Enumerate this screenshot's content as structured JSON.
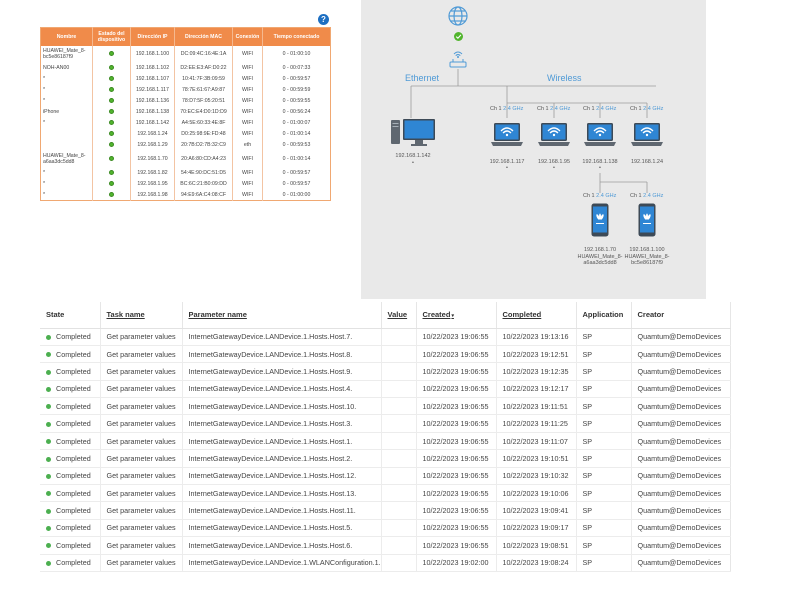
{
  "router": {
    "help_icon": "?",
    "headers": [
      "Nombre",
      "Estado del dispositivo",
      "Dirección IP",
      "Dirección MAC",
      "Conexión",
      "Tiempo conectado"
    ],
    "rows": [
      {
        "name": "HUAWEI_Mate_8-bc5e86187f9",
        "ip": "192.168.1.100",
        "mac": "DC:09:4C:16:4E:1A",
        "conn": "WIFI",
        "time": "0 - 01:00:10",
        "tall": true
      },
      {
        "name": "NOH-AN00",
        "ip": "192.168.1.102",
        "mac": "D2:EE:E3:AF:D0:22",
        "conn": "WIFI",
        "time": "0 - 00:07:33",
        "tall": false
      },
      {
        "name": "*",
        "ip": "192.168.1.107",
        "mac": "10:41:7F:3B:09:59",
        "conn": "WIFI",
        "time": "0 - 00:59:57",
        "tall": false
      },
      {
        "name": "*",
        "ip": "192.168.1.117",
        "mac": "78:7E:61:67:A9:87",
        "conn": "WIFI",
        "time": "0 - 00:59:59",
        "tall": false
      },
      {
        "name": "*",
        "ip": "192.168.1.136",
        "mac": "78:D7:5F:05:20:51",
        "conn": "WIFI",
        "time": "0 - 00:59:55",
        "tall": false
      },
      {
        "name": "iPhone",
        "ip": "192.168.1.138",
        "mac": "70:EC:E4:D0:1D:D9",
        "conn": "WIFI",
        "time": "0 - 00:56:24",
        "tall": false
      },
      {
        "name": "*",
        "ip": "192.168.1.142",
        "mac": "A4:5E:60:33:4E:8F",
        "conn": "WIFI",
        "time": "0 - 01:00:07",
        "tall": false
      },
      {
        "name": "",
        "ip": "192.168.1.24",
        "mac": "D0:25:98:9E:FD:48",
        "conn": "WIFI",
        "time": "0 - 01:00:14",
        "tall": false
      },
      {
        "name": "",
        "ip": "192.168.1.29",
        "mac": "20:7B:D2:7B:32:C9",
        "conn": "eth",
        "time": "0 - 00:59:53",
        "tall": false
      },
      {
        "name": "HUAWEI_Mate_8-a6aa3dc5dd8",
        "ip": "192.168.1.70",
        "mac": "20:A6:80:CD:A4:23",
        "conn": "WIFI",
        "time": "0 - 01:00:14",
        "tall": true
      },
      {
        "name": "*",
        "ip": "192.168.1.82",
        "mac": "54:4E:90:DC:51:D5",
        "conn": "WIFI",
        "time": "0 - 00:59:57",
        "tall": false
      },
      {
        "name": "*",
        "ip": "192.168.1.95",
        "mac": "BC:6C:21:B0:09:DD",
        "conn": "WIFI",
        "time": "0 - 00:59:57",
        "tall": false
      },
      {
        "name": "*",
        "ip": "192.168.1.98",
        "mac": "94:E9:6A:C4:08:CF",
        "conn": "WIFI",
        "time": "0 - 01:00:00",
        "tall": false
      }
    ]
  },
  "topology": {
    "ethernet_label": "Ethernet",
    "wireless_label": "Wireless",
    "channel_prefix": "Ch 1",
    "band": "2.4 GHz",
    "pc_ip": "192.168.1.142",
    "pc_mark": "•",
    "laptops": [
      {
        "ip": "192.168.1.117",
        "mark": "•"
      },
      {
        "ip": "192.168.1.95",
        "mark": "•"
      },
      {
        "ip": "192.168.1.138",
        "mark": "•"
      },
      {
        "ip": "192.168.1.24",
        "mark": ""
      }
    ],
    "phones": [
      {
        "ip": "192.168.1.70",
        "name": "HUAWEI_Mate_8-a6aa3dc5dd8"
      },
      {
        "ip": "192.168.1.100",
        "name": "HUAWEI_Mate_8-bc5e86187f9"
      }
    ],
    "colors": {
      "blue": "#4f9ad6",
      "green": "#52b52e",
      "bg": "#e9e9e9"
    }
  },
  "tasks": {
    "headers": {
      "state": "State",
      "task": "Task name",
      "param": "Parameter name",
      "value": "Value",
      "created": "Created",
      "completed": "Completed",
      "application": "Application",
      "creator": "Creator"
    },
    "sort_arrow": "▾",
    "rows": [
      {
        "state": "Completed",
        "task": "Get parameter values",
        "param": "InternetGatewayDevice.LANDevice.1.Hosts.Host.7.",
        "value": "",
        "created": "10/22/2023 19:06:55",
        "completed": "10/22/2023 19:13:16",
        "app": "SP",
        "creator": "Quamtum@DemoDevices"
      },
      {
        "state": "Completed",
        "task": "Get parameter values",
        "param": "InternetGatewayDevice.LANDevice.1.Hosts.Host.8.",
        "value": "",
        "created": "10/22/2023 19:06:55",
        "completed": "10/22/2023 19:12:51",
        "app": "SP",
        "creator": "Quamtum@DemoDevices"
      },
      {
        "state": "Completed",
        "task": "Get parameter values",
        "param": "InternetGatewayDevice.LANDevice.1.Hosts.Host.9.",
        "value": "",
        "created": "10/22/2023 19:06:55",
        "completed": "10/22/2023 19:12:35",
        "app": "SP",
        "creator": "Quamtum@DemoDevices"
      },
      {
        "state": "Completed",
        "task": "Get parameter values",
        "param": "InternetGatewayDevice.LANDevice.1.Hosts.Host.4.",
        "value": "",
        "created": "10/22/2023 19:06:55",
        "completed": "10/22/2023 19:12:17",
        "app": "SP",
        "creator": "Quamtum@DemoDevices"
      },
      {
        "state": "Completed",
        "task": "Get parameter values",
        "param": "InternetGatewayDevice.LANDevice.1.Hosts.Host.10.",
        "value": "",
        "created": "10/22/2023 19:06:55",
        "completed": "10/22/2023 19:11:51",
        "app": "SP",
        "creator": "Quamtum@DemoDevices"
      },
      {
        "state": "Completed",
        "task": "Get parameter values",
        "param": "InternetGatewayDevice.LANDevice.1.Hosts.Host.3.",
        "value": "",
        "created": "10/22/2023 19:06:55",
        "completed": "10/22/2023 19:11:25",
        "app": "SP",
        "creator": "Quamtum@DemoDevices"
      },
      {
        "state": "Completed",
        "task": "Get parameter values",
        "param": "InternetGatewayDevice.LANDevice.1.Hosts.Host.1.",
        "value": "",
        "created": "10/22/2023 19:06:55",
        "completed": "10/22/2023 19:11:07",
        "app": "SP",
        "creator": "Quamtum@DemoDevices"
      },
      {
        "state": "Completed",
        "task": "Get parameter values",
        "param": "InternetGatewayDevice.LANDevice.1.Hosts.Host.2.",
        "value": "",
        "created": "10/22/2023 19:06:55",
        "completed": "10/22/2023 19:10:51",
        "app": "SP",
        "creator": "Quamtum@DemoDevices"
      },
      {
        "state": "Completed",
        "task": "Get parameter values",
        "param": "InternetGatewayDevice.LANDevice.1.Hosts.Host.12.",
        "value": "",
        "created": "10/22/2023 19:06:55",
        "completed": "10/22/2023 19:10:32",
        "app": "SP",
        "creator": "Quamtum@DemoDevices"
      },
      {
        "state": "Completed",
        "task": "Get parameter values",
        "param": "InternetGatewayDevice.LANDevice.1.Hosts.Host.13.",
        "value": "",
        "created": "10/22/2023 19:06:55",
        "completed": "10/22/2023 19:10:06",
        "app": "SP",
        "creator": "Quamtum@DemoDevices"
      },
      {
        "state": "Completed",
        "task": "Get parameter values",
        "param": "InternetGatewayDevice.LANDevice.1.Hosts.Host.11.",
        "value": "",
        "created": "10/22/2023 19:06:55",
        "completed": "10/22/2023 19:09:41",
        "app": "SP",
        "creator": "Quamtum@DemoDevices"
      },
      {
        "state": "Completed",
        "task": "Get parameter values",
        "param": "InternetGatewayDevice.LANDevice.1.Hosts.Host.5.",
        "value": "",
        "created": "10/22/2023 19:06:55",
        "completed": "10/22/2023 19:09:17",
        "app": "SP",
        "creator": "Quamtum@DemoDevices"
      },
      {
        "state": "Completed",
        "task": "Get parameter values",
        "param": "InternetGatewayDevice.LANDevice.1.Hosts.Host.6.",
        "value": "",
        "created": "10/22/2023 19:06:55",
        "completed": "10/22/2023 19:08:51",
        "app": "SP",
        "creator": "Quamtum@DemoDevices"
      },
      {
        "state": "Completed",
        "task": "Get parameter values",
        "param": "InternetGatewayDevice.LANDevice.1.WLANConfiguration.1.",
        "value": "",
        "created": "10/22/2023 19:02:00",
        "completed": "10/22/2023 19:08:24",
        "app": "SP",
        "creator": "Quamtum@DemoDevices"
      }
    ]
  }
}
